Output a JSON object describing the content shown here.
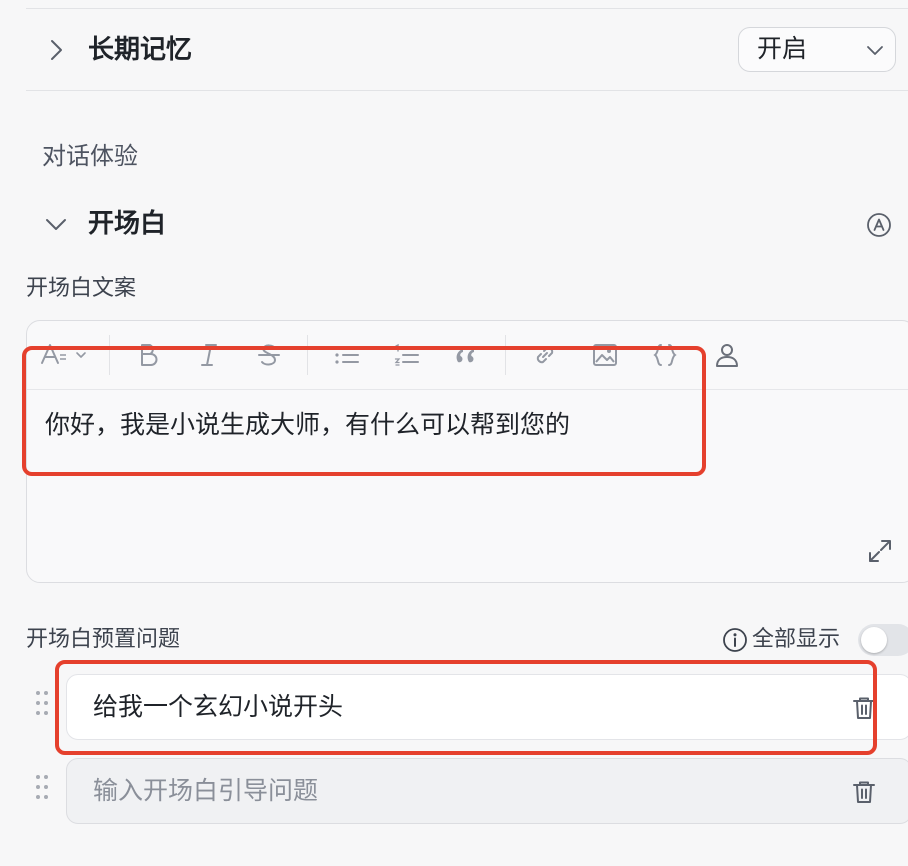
{
  "memory": {
    "title": "长期记忆",
    "select_value": "开启"
  },
  "section": {
    "heading": "对话体验"
  },
  "opening": {
    "title": "开场白",
    "copy_label": "开场白文案",
    "editor_text": "你好，我是小说生成大师，有什么可以帮到您的",
    "questions_label": "开场白预置问题",
    "show_all_label": "全部显示",
    "questions": [
      {
        "value": "给我一个玄幻小说开头"
      }
    ],
    "new_question_placeholder": "输入开场白引导问题"
  },
  "colors": {
    "highlight": "#e5402d"
  },
  "icons": [
    "chevron-right-icon",
    "chevron-down-icon",
    "ai-badge-icon",
    "text-style-icon",
    "bold-icon",
    "italic-icon",
    "strikethrough-icon",
    "bullet-list-icon",
    "numbered-list-icon",
    "quote-icon",
    "link-icon",
    "image-icon",
    "code-block-icon",
    "user-icon",
    "expand-icon",
    "info-icon",
    "drag-handle-icon",
    "trash-icon"
  ]
}
